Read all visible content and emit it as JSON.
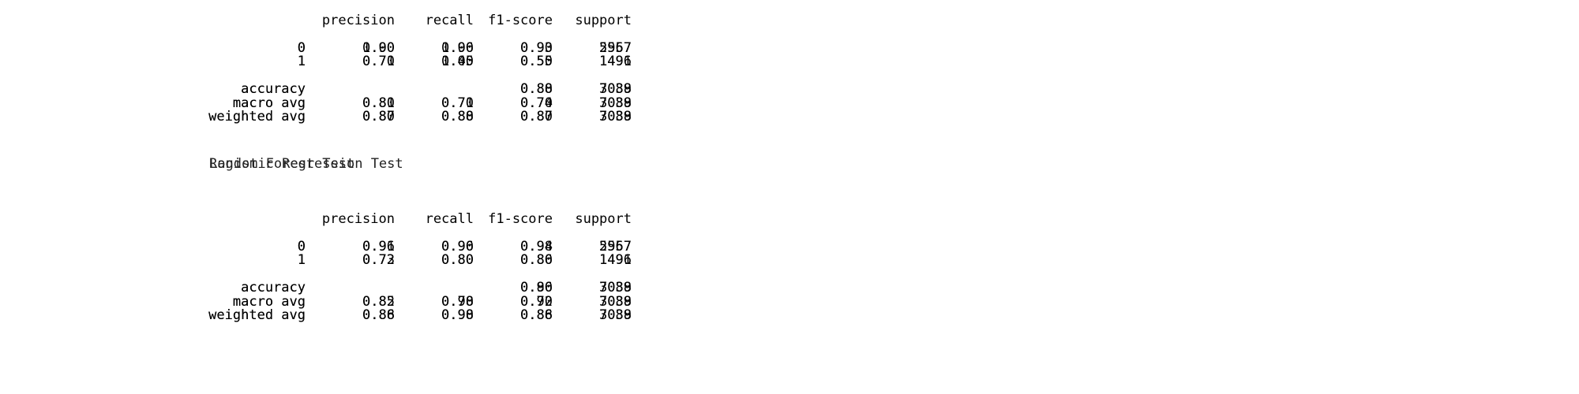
{
  "headers": {
    "precision": "precision",
    "recall": "recall",
    "f1": "f1-score",
    "support": "support"
  },
  "titles": {
    "first": "Logistic Regression Test",
    "second": "Random Forest Test"
  },
  "report_top": {
    "layer_a": {
      "rows": [
        {
          "label": "0",
          "precision": "0.90",
          "recall": "1.00",
          "f1": "0.93",
          "support": "2967"
        },
        {
          "label": "1",
          "precision": "0.71",
          "recall": "0.40",
          "f1": "0.55",
          "support": "1496"
        },
        {
          "label": "accuracy",
          "precision": "",
          "recall": "",
          "f1": "0.88",
          "support": "3038"
        },
        {
          "label": "macro avg",
          "precision": "0.81",
          "recall": "0.70",
          "f1": "0.74",
          "support": "3038"
        },
        {
          "label": "weighted avg",
          "precision": "0.87",
          "recall": "0.88",
          "f1": "0.87",
          "support": "3038"
        }
      ]
    },
    "layer_b": {
      "rows": [
        {
          "label": "0",
          "precision": "1.00",
          "recall": "0.96",
          "f1": "0.90",
          "support": "5557"
        },
        {
          "label": "1",
          "precision": "0.70",
          "recall": "1.05",
          "f1": "0.50",
          "support": "1491"
        },
        {
          "label": "accuracy",
          "precision": "",
          "recall": "",
          "f1": "0.80",
          "support": "7089"
        },
        {
          "label": "macro avg",
          "precision": "0.80",
          "recall": "0.71",
          "f1": "0.70",
          "support": "7089"
        },
        {
          "label": "weighted avg",
          "precision": "0.80",
          "recall": "0.80",
          "f1": "0.80",
          "support": "7089"
        }
      ]
    }
  },
  "report_bottom": {
    "layer_a": {
      "rows": [
        {
          "label": "0",
          "precision": "0.96",
          "recall": "0.90",
          "f1": "0.98",
          "support": "2967"
        },
        {
          "label": "1",
          "precision": "0.73",
          "recall": "0.80",
          "f1": "0.80",
          "support": "1496"
        },
        {
          "label": "accuracy",
          "precision": "",
          "recall": "",
          "f1": "0.90",
          "support": "3038"
        },
        {
          "label": "macro avg",
          "precision": "0.85",
          "recall": "0.90",
          "f1": "0.90",
          "support": "3038"
        },
        {
          "label": "weighted avg",
          "precision": "0.86",
          "recall": "0.90",
          "f1": "0.86",
          "support": "3038"
        }
      ]
    },
    "layer_b": {
      "rows": [
        {
          "label": "0",
          "precision": "0.91",
          "recall": "0.96",
          "f1": "0.94",
          "support": "5557"
        },
        {
          "label": "1",
          "precision": "0.72",
          "recall": "0.80",
          "f1": "0.86",
          "support": "1491"
        },
        {
          "label": "accuracy",
          "precision": "",
          "recall": "",
          "f1": "0.86",
          "support": "7089"
        },
        {
          "label": "macro avg",
          "precision": "0.82",
          "recall": "0.78",
          "f1": "0.72",
          "support": "7089"
        },
        {
          "label": "weighted avg",
          "precision": "0.88",
          "recall": "0.98",
          "f1": "0.88",
          "support": "7089"
        }
      ]
    }
  }
}
